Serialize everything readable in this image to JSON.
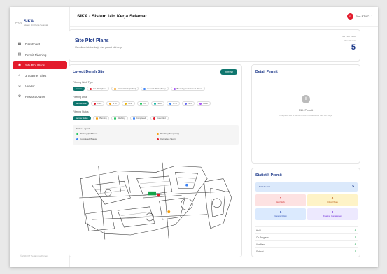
{
  "app": {
    "logo_prefix": "PPLN",
    "logo_name": "SIKA",
    "logo_sub": "Sistem Izin Kerja Selamat",
    "title": "SIKA - Sistem Izin Kerja Selamat",
    "user_initial": "E",
    "user_name": "Ewa PTMC",
    "footer": "© 2024 PT Pertamina Persero"
  },
  "sidebar": {
    "items": [
      {
        "label": "Dashboard",
        "icon": "grid-icon"
      },
      {
        "label": "Permit Planning",
        "icon": "document-icon"
      },
      {
        "label": "Site Plot Plans",
        "icon": "map-pin-icon",
        "active": true
      },
      {
        "label": "3 Scanner Sites",
        "icon": "scanner-icon"
      },
      {
        "label": "Vendor",
        "icon": "users-icon"
      },
      {
        "label": "Product Owner",
        "icon": "gear-icon"
      }
    ]
  },
  "header": {
    "title": "Site Plot Plans",
    "subtitle": "Visualisasi status kerja dan permit plot map",
    "right_line1": "Tapi Tida Value",
    "right_line2": "Total Permit",
    "count": "5"
  },
  "layout_card": {
    "title": "Layout Denah Site",
    "refresh_label": "Refresh",
    "filter_work_type_label": "Filtering Work Type",
    "work_types": [
      {
        "label": "Semua",
        "active": true
      },
      {
        "label": "Hot Work (Fire)",
        "color": "#e31b2c"
      },
      {
        "label": "Critical Work (Caltex)",
        "color": "#f59e0b"
      },
      {
        "label": "General Work (Zone)",
        "color": "#3b82f6"
      },
      {
        "label": "Breaking Containment (Zone)",
        "color": "#a855f7"
      }
    ],
    "filter_area_label": "Filtering Area",
    "areas": [
      {
        "label": "Semua Area",
        "active": true
      },
      {
        "label": "PBO",
        "color": "#e31b2c"
      },
      {
        "label": "VTC",
        "color": "#f59e0b"
      },
      {
        "label": "SCD",
        "color": "#eab308"
      },
      {
        "label": "ITP",
        "color": "#22c55e"
      },
      {
        "label": "SBU",
        "color": "#14b8a6"
      },
      {
        "label": "GTO",
        "color": "#3b82f6"
      },
      {
        "label": "NTA",
        "color": "#6366f1"
      },
      {
        "label": "DMB",
        "color": "#a855f7"
      }
    ],
    "filter_status_label": "Filtering Status",
    "statuses": [
      {
        "label": "Semua Status",
        "active": true
      },
      {
        "label": "Planning",
        "color": "#f59e0b"
      },
      {
        "label": "Working",
        "color": "#22c55e"
      },
      {
        "label": "Completed",
        "color": "#3b82f6"
      },
      {
        "label": "Cancelled",
        "color": "#e31b2c"
      }
    ],
    "legend_title": "Status Legend:",
    "legend": [
      {
        "label": "Working (Full Zone)",
        "color": "#22c55e"
      },
      {
        "label": "Pending (Temporary)",
        "color": "#f59e0b"
      },
      {
        "label": "Completed (Status)",
        "color": "#3b82f6"
      },
      {
        "label": "Cancelled (Stop)",
        "color": "#e31b2c"
      }
    ]
  },
  "detail_card": {
    "title": "Detail Permit",
    "icon_glyph": "i",
    "empty_title": "Pilih Permit",
    "empty_desc": "Klik pada titik di denah untuk melihat detail dari izin kerja"
  },
  "stats_card": {
    "title": "Statistik Permit",
    "total_label": "Total Permit",
    "total_value": "5",
    "boxes": [
      {
        "value": "1",
        "label": "Hot Work",
        "bg": "#fde2e2",
        "fg": "#c81e1e"
      },
      {
        "value": "0",
        "label": "Critical Work",
        "bg": "#fef3c7",
        "fg": "#b45309"
      },
      {
        "value": "1",
        "label": "General Work",
        "bg": "#dbeafe",
        "fg": "#1e40af"
      },
      {
        "value": "0",
        "label": "Breaking Containment",
        "bg": "#ede9fe",
        "fg": "#6d28d9"
      }
    ],
    "rows": [
      {
        "label": "Hold",
        "value": "0",
        "color": "#16a34a"
      },
      {
        "label": "On Progress",
        "value": "1",
        "color": "#16a34a"
      },
      {
        "label": "Verifikasi",
        "value": "0",
        "color": "#16a34a"
      },
      {
        "label": "Selesai",
        "value": "1",
        "color": "#16a34a"
      }
    ]
  }
}
